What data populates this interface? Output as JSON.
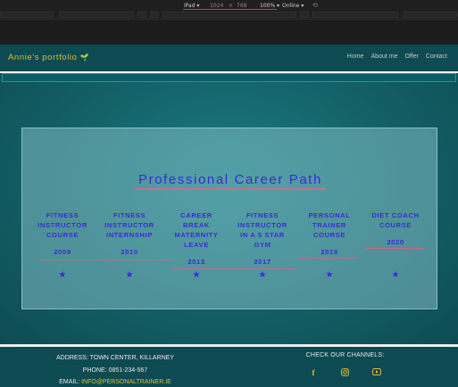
{
  "devtools": {
    "device": "iPad ▾",
    "width": "1024",
    "times": "×",
    "height": "768",
    "zoom": "100% ▾",
    "network": "Online ▾",
    "rotate_icon": "rotate-icon"
  },
  "nav": {
    "brand": "Annie's portfolio",
    "brand_icon": "leaf-icon",
    "links": [
      "Home",
      "About me",
      "Offer",
      "Contact"
    ]
  },
  "career": {
    "title": "Professional Career Path",
    "items": [
      {
        "title_lines": [
          "FITNESS",
          "INSTRUCTOR",
          "COURSE"
        ],
        "year": "2009"
      },
      {
        "title_lines": [
          "FITNESS",
          "INSTRUCTOR",
          "INTERNSHIP"
        ],
        "year": "2010"
      },
      {
        "title_lines": [
          "CAREER",
          "BREAK",
          "MATERNITY",
          "LEAVE"
        ],
        "year": "2013"
      },
      {
        "title_lines": [
          "FITNESS",
          "INSTRUCTOR",
          "IN A 5 STAR",
          "GYM"
        ],
        "year": "2017"
      },
      {
        "title_lines": [
          "PERSONAL",
          "TRAINER",
          "COURSE"
        ],
        "year": "2019"
      },
      {
        "title_lines": [
          "DIET COACH",
          "COURSE"
        ],
        "year": "2020"
      }
    ],
    "marker_icon": "star-icon"
  },
  "footer": {
    "address": "ADDRESS: TOWN CENTER, KILLARNEY",
    "phone": "PHONE: 0851-234-567",
    "email_label": "EMAIL: ",
    "email": "INFO@PERSONALTRAINER.IE",
    "channels_heading": "CHECK OUR CHANNELS:",
    "socials": [
      "facebook-icon",
      "instagram-icon",
      "youtube-icon"
    ]
  },
  "colors": {
    "nav_bg": "#0d4a52",
    "accent_gold": "#e1bd2e",
    "timeline_text": "#3a2ad9"
  }
}
